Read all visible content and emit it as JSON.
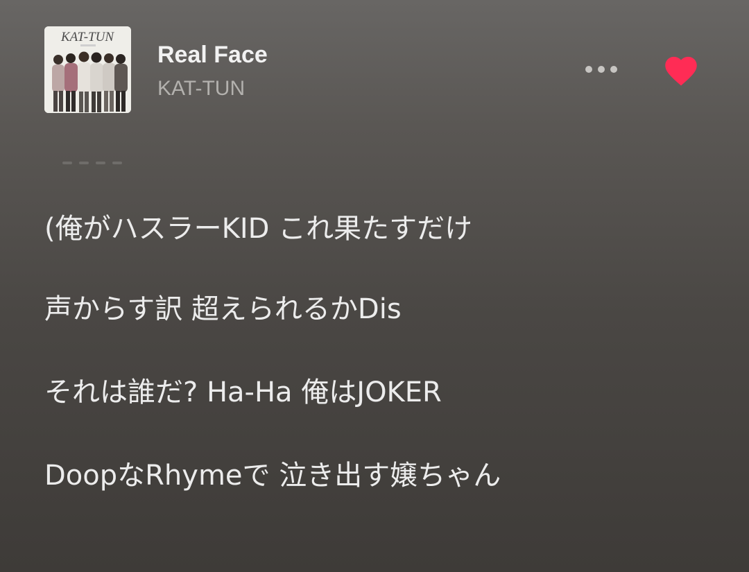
{
  "track": {
    "title": "Real Face",
    "artist": "KAT-TUN",
    "album_art_text": "KAT-TUN",
    "favorited": true
  },
  "lyrics": [
    "(俺がハスラーKID これ果たすだけ",
    "声からす訳 超えられるかDis",
    "それは誰だ? Ha-Ha 俺はJOKER",
    "DoopなRhymeで 泣き出す嬢ちゃん"
  ],
  "colors": {
    "heart": "#ff2c55",
    "title": "#f2f2f2",
    "artist": "#b3b1ae",
    "lyric": "#ececec"
  },
  "icons": {
    "more": "more-dots-icon",
    "favorite": "heart-icon"
  }
}
